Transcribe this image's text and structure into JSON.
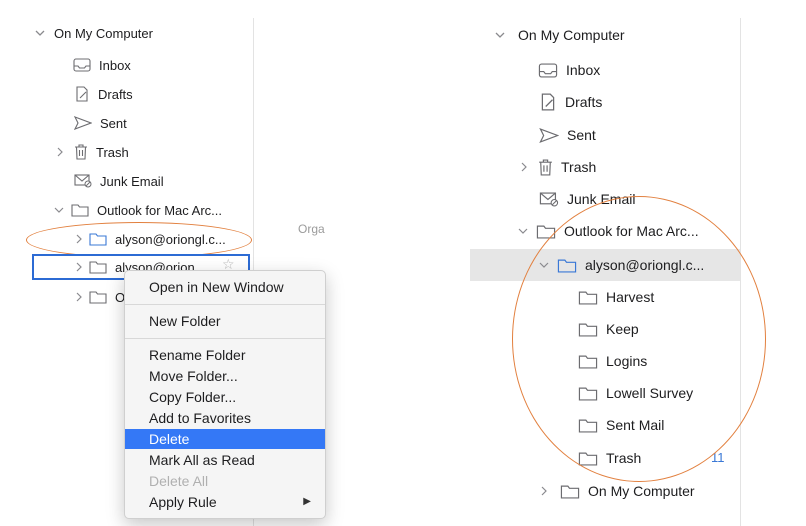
{
  "left": {
    "section": "On My Computer",
    "items": {
      "inbox": "Inbox",
      "drafts": "Drafts",
      "sent": "Sent",
      "trash": "Trash",
      "junk": "Junk Email",
      "archive": "Outlook for Mac Arc...",
      "account1": "alyson@oriongl.c...",
      "account2": "alyson@orion...",
      "account3_partial": "O"
    },
    "middle_partial": "Orga"
  },
  "context_menu": {
    "items": [
      {
        "label": "Open in New Window",
        "enabled": true
      },
      {
        "label": "New Folder",
        "enabled": true
      },
      {
        "label": "Rename Folder",
        "enabled": true
      },
      {
        "label": "Move Folder...",
        "enabled": true
      },
      {
        "label": "Copy Folder...",
        "enabled": true
      },
      {
        "label": "Add to Favorites",
        "enabled": true
      },
      {
        "label": "Delete",
        "enabled": true,
        "highlighted": true
      },
      {
        "label": "Mark All as Read",
        "enabled": true
      },
      {
        "label": "Delete All",
        "enabled": false
      },
      {
        "label": "Apply Rule",
        "enabled": true,
        "submenu": true
      }
    ]
  },
  "right": {
    "section": "On My Computer",
    "items": {
      "inbox": "Inbox",
      "drafts": "Drafts",
      "sent": "Sent",
      "trash": "Trash",
      "junk": "Junk Email",
      "archive": "Outlook for Mac Arc...",
      "account": "alyson@oriongl.c...",
      "on_my_computer": "On My Computer"
    },
    "subfolders": [
      "Harvest",
      "Keep",
      "Logins",
      "Lowell Survey",
      "Sent Mail",
      "Trash"
    ],
    "trash_count": "11"
  },
  "colors": {
    "annotation_oval": "#e2803f",
    "focus": "#2c6bd4",
    "menu_highlight": "#3478f6",
    "badge": "#3a78d6"
  }
}
